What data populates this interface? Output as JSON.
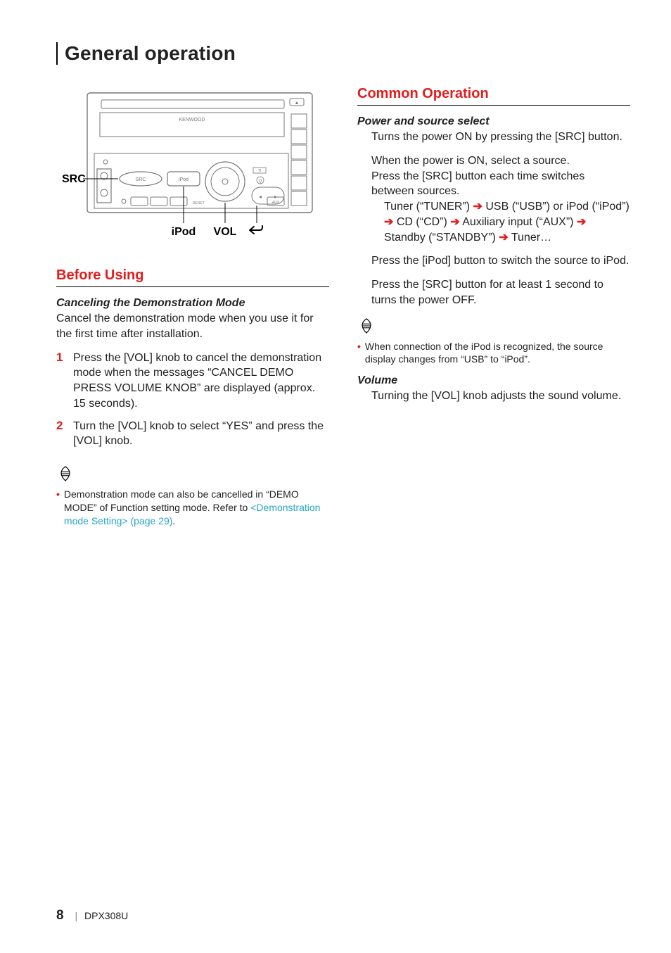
{
  "page_title": "General operation",
  "diagram": {
    "labels": {
      "src": "SRC",
      "ipod": "iPod",
      "vol": "VOL"
    },
    "parts": {
      "brand": "KENWOOD",
      "src_btn": "SRC",
      "ipod_btn": "iPod",
      "aux_label": "AUX",
      "ti_label": "TI",
      "reset_label": "RESET",
      "search_label": "Q"
    }
  },
  "left_col": {
    "section_title": "Before Using",
    "sub_title": "Canceling the Demonstration Mode",
    "intro": "Cancel the demonstration mode when you use it for the first time after installation.",
    "steps": [
      "Press the [VOL] knob to cancel the demonstration mode when the messages “CANCEL DEMO PRESS VOLUME KNOB” are displayed (approx. 15 seconds).",
      "Turn the [VOL] knob to select “YES” and press the [VOL] knob."
    ],
    "notes": [
      {
        "prefix": "Demonstration mode can also be cancelled in “DEMO MODE” of Function setting mode. Refer to ",
        "link": "<Demonstration mode Setting> (page 29)",
        "suffix": "."
      }
    ]
  },
  "right_col": {
    "section_title": "Common Operation",
    "power": {
      "sub_title": "Power and source select",
      "p1": "Turns the power ON by pressing the [SRC] button.",
      "p2": "When the power is ON, select a source.\nPress the [SRC] button each time switches between sources.",
      "chain_segments": [
        "Tuner (“TUNER”) ",
        " USB (“USB”) or iPod (“iPod”) ",
        " CD (“CD”) ",
        " Auxiliary input (“AUX”) ",
        " Standby (“STANDBY”) ",
        " Tuner…"
      ],
      "p3": "Press the [iPod] button to switch the source to iPod.",
      "p4": "Press the [SRC] button for at least 1 second to turns the power OFF."
    },
    "notes": [
      "When connection of the iPod is recognized, the source display changes from “USB” to “iPod”."
    ],
    "volume": {
      "sub_title": "Volume",
      "p1": "Turning the [VOL] knob adjusts the sound volume."
    }
  },
  "footer": {
    "page_number": "8",
    "model": "DPX308U"
  }
}
